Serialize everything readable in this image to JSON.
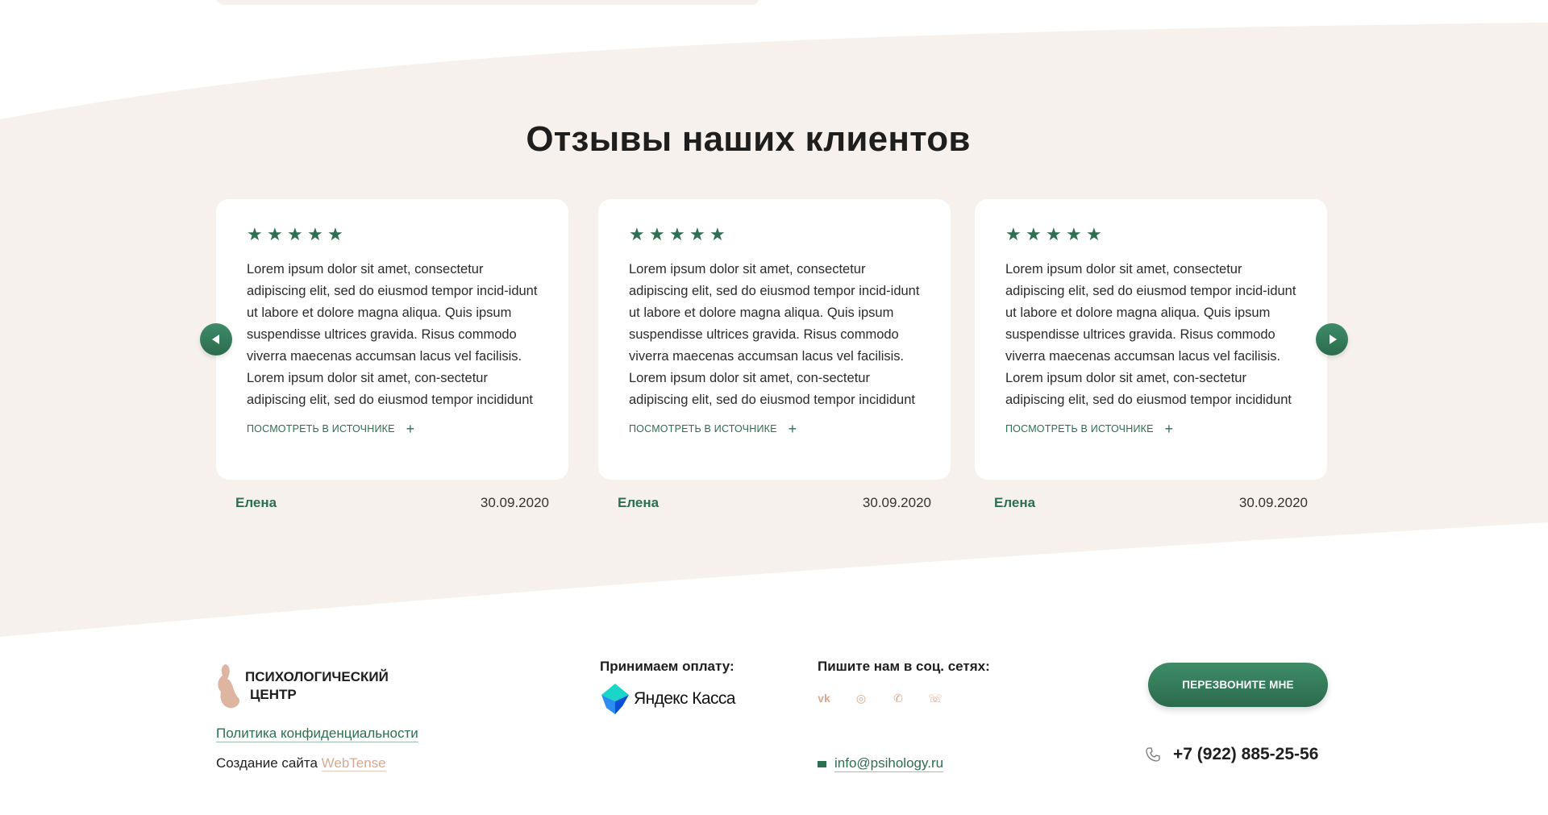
{
  "reviews_section": {
    "title": "Отзывы наших клиентов",
    "stars": 5,
    "cards": [
      {
        "text": "Lorem ipsum dolor sit amet, consectetur adipiscing elit, sed do eiusmod tempor incid-idunt ut labore et dolore magna aliqua. Quis ipsum suspendisse ultrices gravida. Risus commodo viverra maecenas accumsan lacus vel facilisis. Lorem ipsum dolor sit amet, con-sectetur adipiscing elit, sed do eiusmod tempor incididunt ut labore et dolore magna",
        "source_label": "посмотреть в источнике",
        "plus": "+",
        "author": "Елена",
        "date": "30.09.2020"
      },
      {
        "text": "Lorem ipsum dolor sit amet, consectetur adipiscing elit, sed do eiusmod tempor incid-idunt ut labore et dolore magna aliqua. Quis ipsum suspendisse ultrices gravida. Risus commodo viverra maecenas accumsan lacus vel facilisis. Lorem ipsum dolor sit amet, con-sectetur adipiscing elit, sed do eiusmod tempor incididunt ut labore et dolore magna",
        "source_label": "посмотреть в источнике",
        "plus": "+",
        "author": "Елена",
        "date": "30.09.2020"
      },
      {
        "text": "Lorem ipsum dolor sit amet, consectetur adipiscing elit, sed do eiusmod tempor incid-idunt ut labore et dolore magna aliqua. Quis ipsum suspendisse ultrices gravida. Risus commodo viverra maecenas accumsan lacus vel facilisis. Lorem ipsum dolor sit amet, con-sectetur adipiscing elit, sed do eiusmod tempor incididunt ut labore et dolore magna",
        "source_label": "посмотреть в источнике",
        "plus": "+",
        "author": "Елена",
        "date": "30.09.2020"
      }
    ],
    "nav": {
      "prev_icon": "chevron-left-icon",
      "next_icon": "chevron-right-icon"
    }
  },
  "footer": {
    "logo_line1": "Психологический",
    "logo_line2": "центр",
    "privacy_link": "Политика конфиденциальности",
    "credits_prefix": "Создание сайта ",
    "credits_link": "WebTense",
    "payment_label": "Принимаем оплату:",
    "payment_provider": "Яндекс Касса",
    "social_label": "Пишите нам в соц. сетях:",
    "socials": [
      {
        "name": "vk-icon",
        "glyph": "vk"
      },
      {
        "name": "instagram-icon",
        "glyph": "◎"
      },
      {
        "name": "whatsapp-icon",
        "glyph": "✆"
      },
      {
        "name": "viber-icon",
        "glyph": "☏"
      }
    ],
    "email": "info@psihology.ru",
    "cta_label": "Перезвоните мне",
    "phone": "+7 (922) 885-25-56"
  },
  "colors": {
    "accent": "#2e6e52",
    "section_bg": "#f7f1ed",
    "peach": "#d9a98f"
  }
}
